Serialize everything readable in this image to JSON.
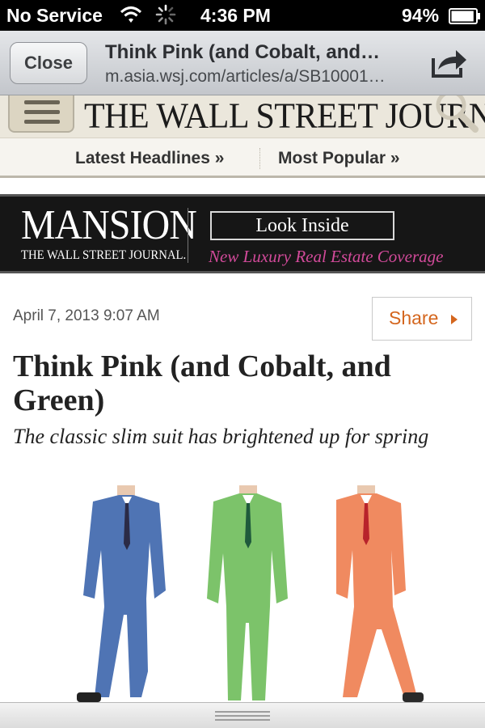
{
  "status_bar": {
    "carrier": "No Service",
    "time": "4:36 PM",
    "battery": "94%",
    "battery_level": 0.94,
    "icons": [
      "wifi-icon",
      "activity-spinner-icon",
      "battery-icon"
    ]
  },
  "browser": {
    "close_label": "Close",
    "title": "Think Pink (and Cobalt, and…",
    "url": "m.asia.wsj.com/articles/a/SB10001…",
    "icons": [
      "share-icon"
    ]
  },
  "site_header": {
    "logo": "THE WALL STREET JOURNAL.",
    "icons": [
      "menu-icon",
      "search-icon"
    ],
    "background": "#ebe7dc"
  },
  "nav": {
    "items": [
      {
        "label": "Latest Headlines »"
      },
      {
        "label": "Most Popular »"
      }
    ]
  },
  "ad": {
    "brand": "MANSION",
    "brand_sub": "THE WALL STREET JOURNAL.",
    "cta": "Look Inside",
    "tagline": "New Luxury Real Estate Coverage",
    "tagline_color": "#d24a9a"
  },
  "article": {
    "dateline": "April 7, 2013 9:07 AM",
    "share_label": "Share",
    "share_color": "#d4661e",
    "headline": "Think Pink (and Cobalt, and Green)",
    "dek": "The classic slim suit has brightened up for spring",
    "hero_suit_colors": [
      "#4f74b4",
      "#7cc36a",
      "#f08a60"
    ]
  }
}
